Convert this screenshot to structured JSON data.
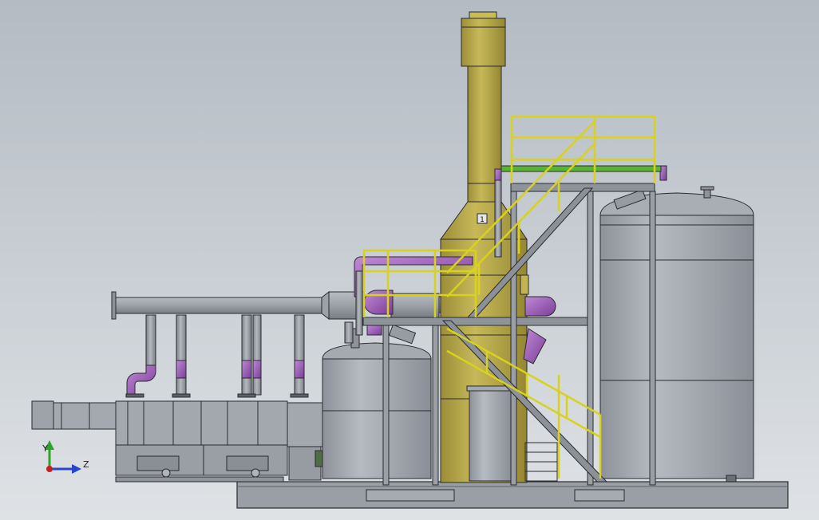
{
  "viewport": {
    "background_top": "#b4bbc3",
    "background_bottom": "#dfe2e5"
  },
  "colors": {
    "steel": "#8f949c",
    "steel_dark": "#6f747b",
    "tank": "#9a9ea6",
    "tank_light": "#b3b7be",
    "stack": "#a99a3f",
    "stack_light": "#c2b453",
    "railing": "#d8d21c",
    "elbow": "#9a55b8",
    "pipe_green": "#58b534",
    "outline": "#2a2b2e"
  },
  "triad": {
    "label_y": "Y",
    "label_z": "Z",
    "y_color": "#2aa52a",
    "z_color": "#2846c8",
    "origin_color": "#c81e1e"
  },
  "callout": {
    "label": "1"
  }
}
